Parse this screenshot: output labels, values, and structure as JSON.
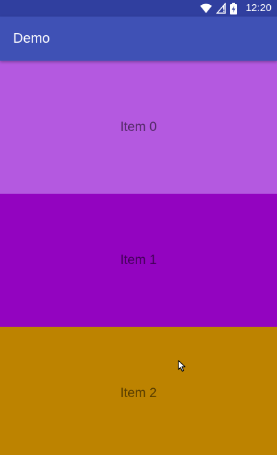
{
  "status_bar": {
    "time": "12:20",
    "icons": [
      "wifi-icon",
      "signal-icon",
      "battery-charging-icon"
    ],
    "background": "#303F9F"
  },
  "app_bar": {
    "title": "Demo",
    "background": "#3F51B5"
  },
  "list": {
    "items": [
      {
        "label": "Item 0",
        "color": "#B459E0"
      },
      {
        "label": "Item 1",
        "color": "#9304C0"
      },
      {
        "label": "Item 2",
        "color": "#BD8300"
      }
    ]
  },
  "cursor": {
    "icon": "mouse-pointer-icon"
  }
}
